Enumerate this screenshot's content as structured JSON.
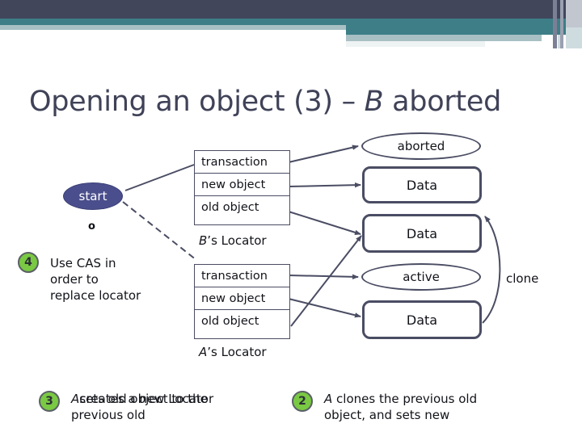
{
  "slide": {
    "title_prefix": "Opening an object (3) – ",
    "title_italic": "B",
    "title_suffix": " aborted"
  },
  "colors": {
    "header_dark": "#41465a",
    "header_teal": "#3d7e87",
    "header_light": "#a8c0c4",
    "ink": "#4a4d63",
    "start_fill": "#4a4e8c",
    "badge_green": "#7ac943"
  },
  "nodes": {
    "start_ellipse": "start",
    "start_marker": "o",
    "aborted_ellipse": "aborted",
    "active_ellipse": "active",
    "clone_label": "clone",
    "data_top": "Data",
    "data_mid": "Data",
    "data_bottom": "Data"
  },
  "locator_b": {
    "caption_italic": "B",
    "caption_rest": "’s Locator",
    "rows": [
      "transaction",
      "new object",
      "old object"
    ]
  },
  "locator_a": {
    "caption_italic": "A",
    "caption_rest": "’s Locator",
    "rows": [
      "transaction",
      "new object",
      "old object"
    ]
  },
  "steps": [
    {
      "number": "4",
      "lines": [
        "Use CAS in",
        "order to",
        "replace locator"
      ]
    },
    {
      "number": "3",
      "italic_lead": "A",
      "overlap_line_a": " sets old object to the",
      "overlap_line_b": " creates a new Locator",
      "line2": "previous old"
    },
    {
      "number": "2",
      "italic_lead": "A",
      "line1": " clones the previous old",
      "line2": "object, and sets new"
    }
  ]
}
